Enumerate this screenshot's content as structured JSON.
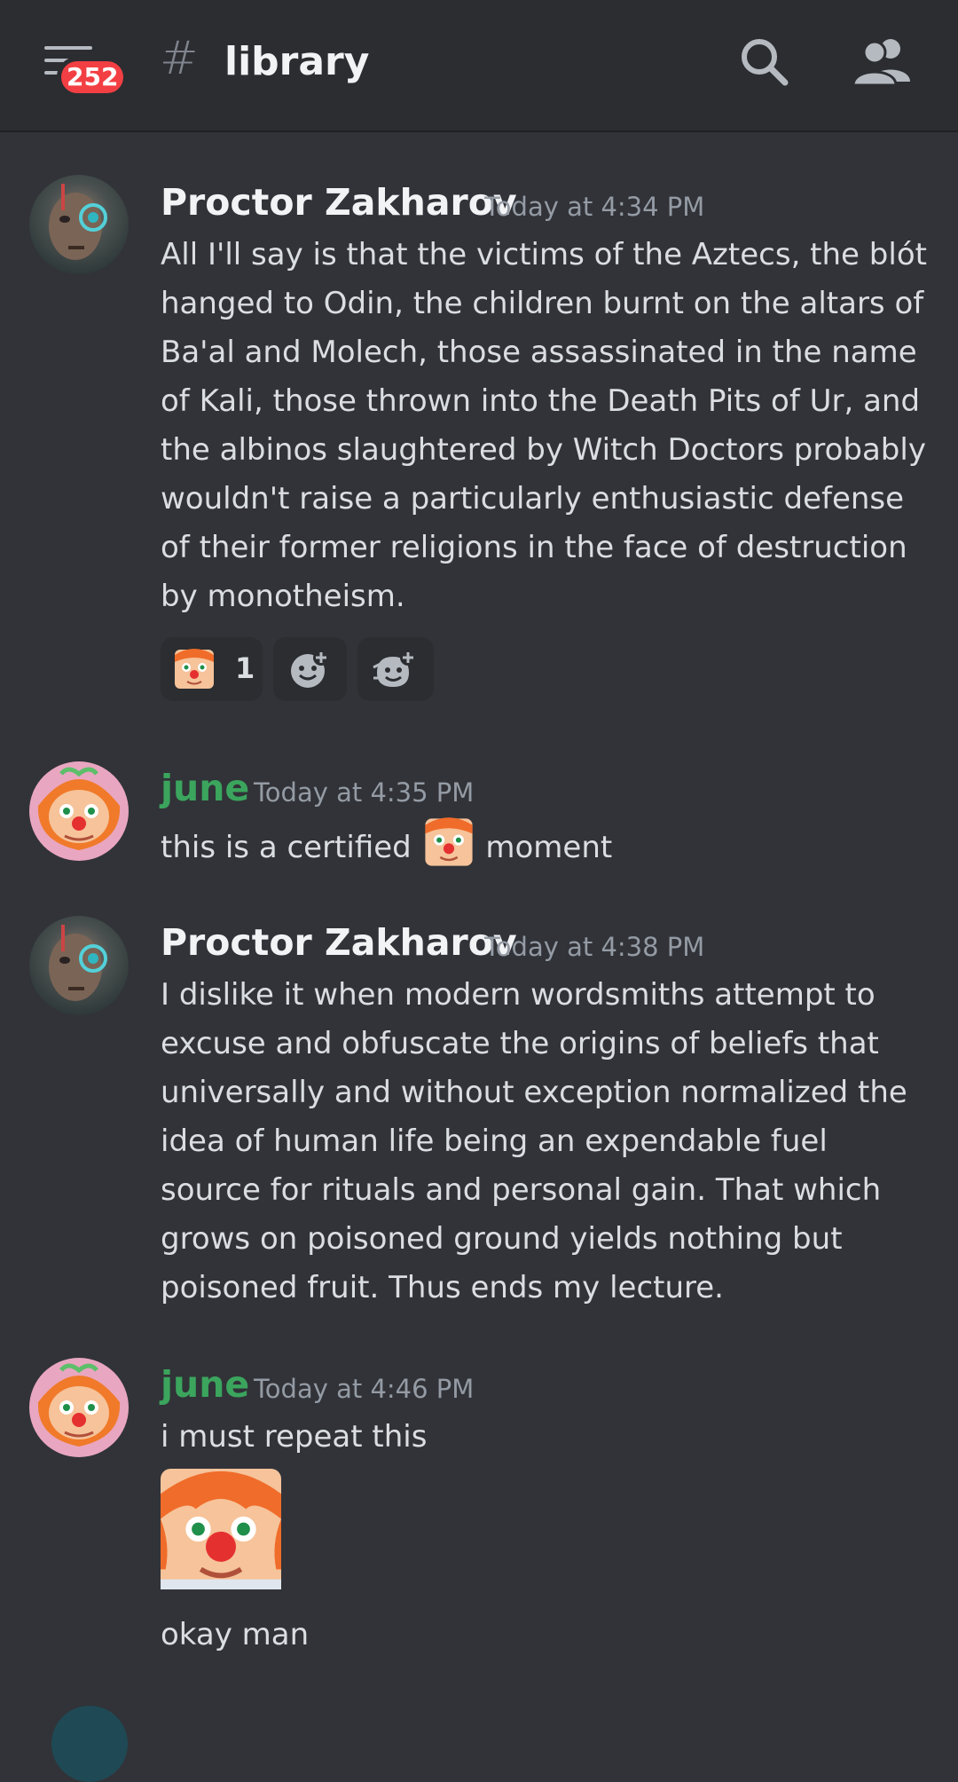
{
  "header": {
    "unread_badge": "252",
    "channel_prefix": "#",
    "channel_name": "library",
    "icons": [
      "menu-icon",
      "search-icon",
      "members-icon"
    ]
  },
  "messages": [
    {
      "author": "Proctor Zakharov",
      "author_color": "#f2f3f5",
      "timestamp": "Today at 4:34 PM",
      "text": "All I'll say is that the victims of the Aztecs, the blót hanged to Odin, the children burnt on the altars of Ba'al and Molech, those assassinated in the name of Kali, those thrown into the Death Pits of Ur, and the albinos slaughtered by Witch Doctors probably wouldn't raise a particularly enthusiastic defense of their former religions in the face of destruction by monotheism.",
      "reactions": [
        {
          "emoji": "clown-emoji",
          "count": "1"
        },
        {
          "emoji": "add-reaction-icon"
        },
        {
          "emoji": "add-super-reaction-icon"
        }
      ]
    },
    {
      "author": "june",
      "author_color": "#3ba55d",
      "timestamp": "Today at 4:35 PM",
      "text_before": "this is a certified",
      "text_after": "moment",
      "inline_emoji": "clown-emoji"
    },
    {
      "author": "Proctor Zakharov",
      "author_color": "#f2f3f5",
      "timestamp": "Today at 4:38 PM",
      "text": "I dislike it when modern wordsmiths attempt to excuse and obfuscate the origins of beliefs that universally and without exception normalized the idea of human life being an expendable fuel source for rituals and personal gain. That which grows on poisoned ground yields nothing but poisoned fruit. Thus ends my lecture."
    },
    {
      "author": "june",
      "author_color": "#3ba55d",
      "timestamp": "Today at 4:46 PM",
      "text": "i must repeat this",
      "large_emoji": "clown-emoji",
      "followup_text": "okay man"
    }
  ]
}
